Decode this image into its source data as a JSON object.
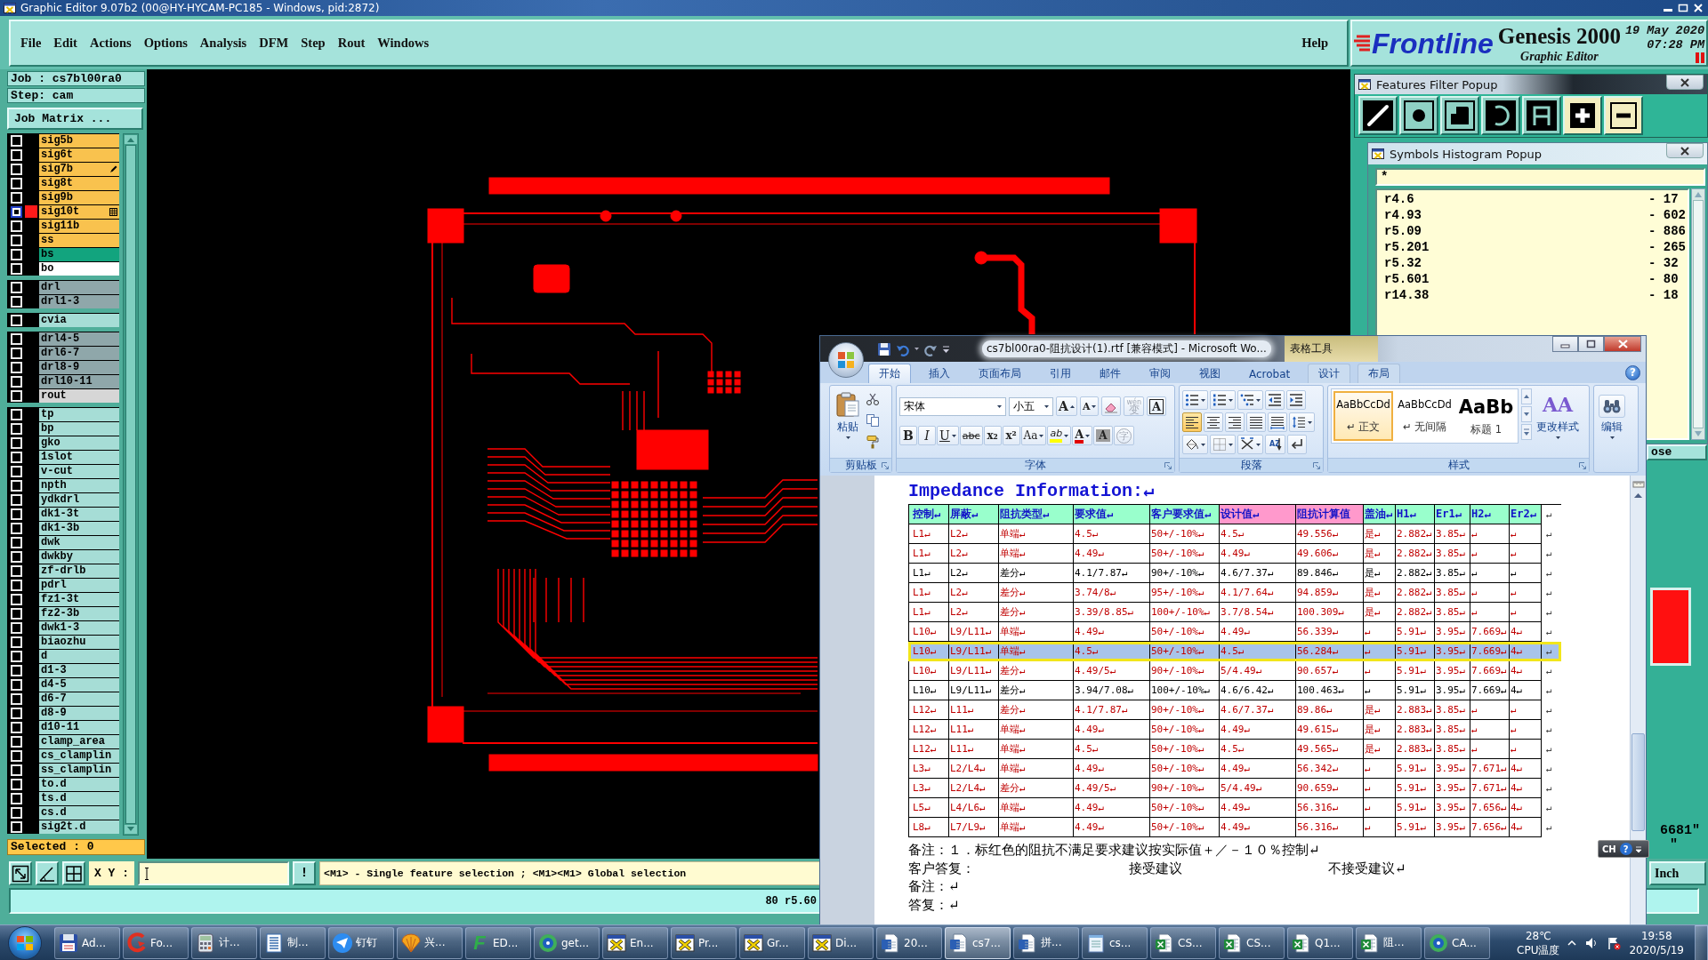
{
  "genesis": {
    "title": "Graphic Editor 9.07b2 (00@HY-HYCAM-PC185 - Windows, pid:2872)",
    "menu": [
      "File",
      "Edit",
      "Actions",
      "Options",
      "Analysis",
      "DFM",
      "Step",
      "Rout",
      "Windows"
    ],
    "help": "Help",
    "brand": {
      "logo": "Frontline",
      "product": "Genesis 2000",
      "subtitle": "Graphic Editor",
      "date": "19 May 2020",
      "time": "07:28 PM"
    },
    "job": "Job : cs7bl00ra0",
    "step": "Step: cam",
    "job_matrix": "Job Matrix ...",
    "layer_groups": [
      [
        {
          "name": "sig5b",
          "kind": "plain",
          "color": "#f9c24e",
          "checked": false,
          "displayed": false
        },
        {
          "name": "sig6t",
          "kind": "plain",
          "color": "#f9c24e",
          "checked": false,
          "displayed": false
        },
        {
          "name": "sig7b",
          "kind": "edited",
          "color": "#f9c24e",
          "checked": false,
          "displayed": false
        },
        {
          "name": "sig8t",
          "kind": "plain",
          "color": "#f9c24e",
          "checked": false,
          "displayed": false
        },
        {
          "name": "sig9b",
          "kind": "plain",
          "color": "#f9c24e",
          "checked": false,
          "displayed": false
        },
        {
          "name": "sig10t",
          "kind": "work",
          "color": "#f9c24e",
          "checked": true,
          "displayed": true
        },
        {
          "name": "sig11b",
          "kind": "plain",
          "color": "#f9c24e",
          "checked": false,
          "displayed": false
        },
        {
          "name": "ss",
          "kind": "plain",
          "color": "#f9c24e",
          "checked": false,
          "displayed": false
        },
        {
          "name": "bs",
          "kind": "plain",
          "color": "#12a47e",
          "checked": false,
          "displayed": false
        },
        {
          "name": "bo",
          "kind": "plain",
          "color": "#ffffff",
          "checked": false,
          "displayed": false
        }
      ],
      [
        {
          "name": "drl",
          "kind": "plain",
          "color": "#8fa7aa",
          "checked": false,
          "displayed": false
        },
        {
          "name": "drl1-3",
          "kind": "plain",
          "color": "#8fa7aa",
          "checked": false,
          "displayed": false
        }
      ],
      [
        {
          "name": "cvia",
          "kind": "plain",
          "color": "#a6ddd6",
          "checked": false,
          "displayed": false
        }
      ],
      [
        {
          "name": "drl4-5",
          "kind": "plain",
          "color": "#8fa7aa",
          "checked": false,
          "displayed": false
        },
        {
          "name": "drl6-7",
          "kind": "plain",
          "color": "#8fa7aa",
          "checked": false,
          "displayed": false
        },
        {
          "name": "drl8-9",
          "kind": "plain",
          "color": "#8fa7aa",
          "checked": false,
          "displayed": false
        },
        {
          "name": "drl10-11",
          "kind": "plain",
          "color": "#8fa7aa",
          "checked": false,
          "displayed": false
        },
        {
          "name": "rout",
          "kind": "plain",
          "color": "#d6d6d6",
          "checked": false,
          "displayed": false
        }
      ],
      [
        {
          "name": "tp",
          "kind": "plain",
          "color": "#a6ddd6",
          "checked": false,
          "displayed": false
        },
        {
          "name": "bp",
          "kind": "plain",
          "color": "#a6ddd6",
          "checked": false,
          "displayed": false
        },
        {
          "name": "gko",
          "kind": "plain",
          "color": "#a6ddd6",
          "checked": false,
          "displayed": false
        },
        {
          "name": "1slot",
          "kind": "plain",
          "color": "#a6ddd6",
          "checked": false,
          "displayed": false
        },
        {
          "name": "v-cut",
          "kind": "plain",
          "color": "#a6ddd6",
          "checked": false,
          "displayed": false
        },
        {
          "name": "npth",
          "kind": "plain",
          "color": "#a6ddd6",
          "checked": false,
          "displayed": false
        },
        {
          "name": "ydkdrl",
          "kind": "plain",
          "color": "#a6ddd6",
          "checked": false,
          "displayed": false
        },
        {
          "name": "dk1-3t",
          "kind": "plain",
          "color": "#a6ddd6",
          "checked": false,
          "displayed": false
        },
        {
          "name": "dk1-3b",
          "kind": "plain",
          "color": "#a6ddd6",
          "checked": false,
          "displayed": false
        },
        {
          "name": "dwk",
          "kind": "plain",
          "color": "#a6ddd6",
          "checked": false,
          "displayed": false
        },
        {
          "name": "dwkby",
          "kind": "plain",
          "color": "#a6ddd6",
          "checked": false,
          "displayed": false
        },
        {
          "name": "zf-drlb",
          "kind": "plain",
          "color": "#a6ddd6",
          "checked": false,
          "displayed": false
        },
        {
          "name": "pdrl",
          "kind": "plain",
          "color": "#a6ddd6",
          "checked": false,
          "displayed": false
        },
        {
          "name": "fz1-3t",
          "kind": "plain",
          "color": "#a6ddd6",
          "checked": false,
          "displayed": false
        },
        {
          "name": "fz2-3b",
          "kind": "plain",
          "color": "#a6ddd6",
          "checked": false,
          "displayed": false
        },
        {
          "name": "dwk1-3",
          "kind": "plain",
          "color": "#a6ddd6",
          "checked": false,
          "displayed": false
        },
        {
          "name": "biaozhu",
          "kind": "plain",
          "color": "#a6ddd6",
          "checked": false,
          "displayed": false
        },
        {
          "name": "d",
          "kind": "plain",
          "color": "#a6ddd6",
          "checked": false,
          "displayed": false
        },
        {
          "name": "d1-3",
          "kind": "plain",
          "color": "#a6ddd6",
          "checked": false,
          "displayed": false
        },
        {
          "name": "d4-5",
          "kind": "plain",
          "color": "#a6ddd6",
          "checked": false,
          "displayed": false
        },
        {
          "name": "d6-7",
          "kind": "plain",
          "color": "#a6ddd6",
          "checked": false,
          "displayed": false
        },
        {
          "name": "d8-9",
          "kind": "plain",
          "color": "#a6ddd6",
          "checked": false,
          "displayed": false
        },
        {
          "name": "d10-11",
          "kind": "plain",
          "color": "#a6ddd6",
          "checked": false,
          "displayed": false
        },
        {
          "name": "clamp_area",
          "kind": "plain",
          "color": "#a6ddd6",
          "checked": false,
          "displayed": false
        },
        {
          "name": "cs_clamplin",
          "kind": "plain",
          "color": "#a6ddd6",
          "checked": false,
          "displayed": false
        },
        {
          "name": "ss_clamplin",
          "kind": "plain",
          "color": "#a6ddd6",
          "checked": false,
          "displayed": false
        },
        {
          "name": "to.d",
          "kind": "plain",
          "color": "#a6ddd6",
          "checked": false,
          "displayed": false
        },
        {
          "name": "ts.d",
          "kind": "plain",
          "color": "#a6ddd6",
          "checked": false,
          "displayed": false
        },
        {
          "name": "cs.d",
          "kind": "plain",
          "color": "#a6ddd6",
          "checked": false,
          "displayed": false
        },
        {
          "name": "sig2t.d",
          "kind": "plain",
          "color": "#a6ddd6",
          "checked": false,
          "displayed": false
        }
      ]
    ],
    "selected": "Selected : 0",
    "coord_label": "X Y :",
    "exec": "!",
    "hint": "<M1> - Single feature selection ; <M1><M1> Global selection",
    "unit": "Inch",
    "status": "80 r5.60",
    "side": {
      "close": "ose",
      "reading": "6681\"",
      "reading_2": "\""
    }
  },
  "features_filter": {
    "title": "Features Filter Popup",
    "tools": [
      {
        "kind": "line"
      },
      {
        "kind": "pad"
      },
      {
        "kind": "surface"
      },
      {
        "kind": "arc"
      },
      {
        "kind": "text"
      },
      {
        "kind": "positive"
      },
      {
        "kind": "negative"
      }
    ]
  },
  "symbols_histogram": {
    "title": "Symbols Histogram Popup",
    "filter": "*",
    "rows": [
      {
        "symbol": "r4.6",
        "count": "- 17"
      },
      {
        "symbol": "r4.93",
        "count": "- 602"
      },
      {
        "symbol": "r5.09",
        "count": "- 886"
      },
      {
        "symbol": "r5.201",
        "count": "- 265"
      },
      {
        "symbol": "r5.32",
        "count": "- 32"
      },
      {
        "symbol": "r5.601",
        "count": "- 80"
      },
      {
        "symbol": "r14.38",
        "count": "- 18"
      }
    ]
  },
  "ime": {
    "lang": "CH",
    "help": "?"
  },
  "word": {
    "title": "cs7bl00ra0-阻抗设计(1).rtf [兼容模式] - Microsoft Wo...",
    "context": "表格工具",
    "help": "?",
    "tabs": [
      {
        "label": "开始",
        "selected": true,
        "contextual": false
      },
      {
        "label": "插入",
        "selected": false,
        "contextual": false
      },
      {
        "label": "页面布局",
        "selected": false,
        "contextual": false
      },
      {
        "label": "引用",
        "selected": false,
        "contextual": false
      },
      {
        "label": "邮件",
        "selected": false,
        "contextual": false
      },
      {
        "label": "审阅",
        "selected": false,
        "contextual": false
      },
      {
        "label": "视图",
        "selected": false,
        "contextual": false
      },
      {
        "label": "Acrobat",
        "selected": false,
        "contextual": false
      },
      {
        "label": "设计",
        "selected": false,
        "contextual": true
      },
      {
        "label": "布局",
        "selected": false,
        "contextual": true
      }
    ],
    "clipboard": {
      "title": "剪贴板",
      "paste": "粘贴"
    },
    "font": {
      "title": "字体",
      "face": "宋体",
      "size": "小五",
      "row1": [
        {
          "kind": "grow",
          "text": "A",
          "disabled": false
        },
        {
          "kind": "shrink",
          "text": "A",
          "disabled": false
        },
        {
          "kind": "clear",
          "disabled": false
        },
        {
          "kind": "phonetic",
          "text": "变",
          "ruby": "wén",
          "disabled": true
        },
        {
          "kind": "border",
          "text": "A",
          "disabled": false
        }
      ],
      "row2": [
        {
          "kind": "bold",
          "text": "B",
          "disabled": false
        },
        {
          "kind": "italic",
          "text": "I",
          "disabled": false
        },
        {
          "kind": "underline",
          "text": "U",
          "disabled": false
        },
        {
          "kind": "strike",
          "text": "abc",
          "disabled": false
        },
        {
          "kind": "subscript",
          "text": "x₂",
          "disabled": false
        },
        {
          "kind": "superscript",
          "text": "x²",
          "disabled": false
        },
        {
          "kind": "case",
          "text": "Aa",
          "disabled": false
        },
        {
          "kind": "highlight",
          "text": "ab",
          "disabled": false
        },
        {
          "kind": "color",
          "text": "A",
          "disabled": false
        },
        {
          "kind": "shading",
          "text": "A",
          "disabled": false
        },
        {
          "kind": "enclose",
          "text": "字",
          "disabled": true
        }
      ]
    },
    "paragraph": {
      "title": "段落",
      "rows": [
        [
          {
            "kind": "bullets",
            "selected": false
          },
          {
            "kind": "numbering",
            "selected": false
          },
          {
            "kind": "multilevel",
            "selected": false
          },
          {
            "kind": "outdent",
            "selected": false
          },
          {
            "kind": "indent",
            "selected": false
          }
        ],
        [
          {
            "kind": "align-left",
            "selected": true
          },
          {
            "kind": "align-center",
            "selected": false
          },
          {
            "kind": "align-right",
            "selected": false
          },
          {
            "kind": "justify",
            "selected": false
          },
          {
            "kind": "distribute",
            "selected": false
          },
          {
            "kind": "line-spacing",
            "selected": false
          }
        ],
        [
          {
            "kind": "fill",
            "selected": false
          },
          {
            "kind": "borders",
            "selected": false
          },
          {
            "kind": "asian",
            "selected": false
          },
          {
            "kind": "sort",
            "text": "AZ",
            "selected": false
          },
          {
            "kind": "marks",
            "selected": false
          }
        ]
      ]
    },
    "styles": {
      "title": "样式",
      "items": [
        {
          "kind": "normal",
          "sample": "AaBbCcDd",
          "name": "↵ 正文",
          "selected": true
        },
        {
          "kind": "normal",
          "sample": "AaBbCcDd",
          "name": "↵ 无间隔",
          "selected": false
        },
        {
          "kind": "heading",
          "sample": "AaBb",
          "name": "标题 1",
          "selected": false
        }
      ],
      "icon": "AA",
      "change": "更改样式"
    },
    "editing": {
      "label": "编辑"
    },
    "document": {
      "heading": "Impedance Information:↵",
      "columns": [
        {
          "label": "控制↵",
          "color": "#99ffcc"
        },
        {
          "label": "屏蔽↵",
          "color": "#99ffcc"
        },
        {
          "label": "阻抗类型↵",
          "color": "#99ffcc"
        },
        {
          "label": "要求值↵",
          "color": "#99ffcc"
        },
        {
          "label": "客户要求值↵",
          "color": "#99ffcc"
        },
        {
          "label": "设计值↵",
          "color": "#ff99cc"
        },
        {
          "label": "阻抗计算值",
          "color": "#ff99cc"
        },
        {
          "label": "盖油↵",
          "color": "#99ffcc"
        },
        {
          "label": "H1↵",
          "color": "#99ffcc"
        },
        {
          "label": "Er1↵",
          "color": "#99ffcc"
        },
        {
          "label": "H2↵",
          "color": "#99ffcc"
        },
        {
          "label": "Er2↵",
          "color": "#99ffcc"
        }
      ],
      "header_end": "↵",
      "rows": [
        {
          "cells": [
            "L1↵",
            "L2↵",
            "单端↵",
            "4.5↵",
            "50+/-10%↵",
            "4.5↵",
            "49.556↵",
            "是↵",
            "2.882↵",
            "3.85↵",
            "↵",
            "↵"
          ],
          "flagged": true,
          "selected": false,
          "end": "↵"
        },
        {
          "cells": [
            "L1↵",
            "L2↵",
            "单端↵",
            "4.49↵",
            "50+/-10%↵",
            "4.49↵",
            "49.606↵",
            "是↵",
            "2.882↵",
            "3.85↵",
            "↵",
            "↵"
          ],
          "flagged": true,
          "selected": false,
          "end": "↵"
        },
        {
          "cells": [
            "L1↵",
            "L2↵",
            "差分↵",
            "4.1/7.87↵",
            "90+/-10%↵",
            "4.6/7.37↵",
            "89.846↵",
            "是↵",
            "2.882↵",
            "3.85↵",
            "↵",
            "↵"
          ],
          "flagged": false,
          "selected": false,
          "end": "↵"
        },
        {
          "cells": [
            "L1↵",
            "L2↵",
            "差分↵",
            "3.74/8↵",
            "95+/-10%↵",
            "4.1/7.64↵",
            "94.859↵",
            "是↵",
            "2.882↵",
            "3.85↵",
            "↵",
            "↵"
          ],
          "flagged": true,
          "selected": false,
          "end": "↵"
        },
        {
          "cells": [
            "L1↵",
            "L2↵",
            "差分↵",
            "3.39/8.85↵",
            "100+/-10%↵",
            "3.7/8.54↵",
            "100.309↵",
            "是↵",
            "2.882↵",
            "3.85↵",
            "↵",
            "↵"
          ],
          "flagged": true,
          "selected": false,
          "end": "↵"
        },
        {
          "cells": [
            "L10↵",
            "L9/L11↵",
            "单端↵",
            "4.49↵",
            "50+/-10%↵",
            "4.49↵",
            "56.339↵",
            "↵",
            "5.91↵",
            "3.95↵",
            "7.669↵",
            "4↵"
          ],
          "flagged": true,
          "selected": false,
          "end": "↵"
        },
        {
          "cells": [
            "L10↵",
            "L9/L11↵",
            "单端↵",
            "4.5↵",
            "50+/-10%↵",
            "4.5↵",
            "56.284↵",
            "↵",
            "5.91↵",
            "3.95↵",
            "7.669↵",
            "4↵"
          ],
          "flagged": true,
          "selected": true,
          "end": "↵"
        },
        {
          "cells": [
            "L10↵",
            "L9/L11↵",
            "差分↵",
            "4.49/5↵",
            "90+/-10%↵",
            "5/4.49↵",
            "90.657↵",
            "↵",
            "5.91↵",
            "3.95↵",
            "7.669↵",
            "4↵"
          ],
          "flagged": true,
          "selected": false,
          "end": "↵"
        },
        {
          "cells": [
            "L10↵",
            "L9/L11↵",
            "差分↵",
            "3.94/7.08↵",
            "100+/-10%↵",
            "4.6/6.42↵",
            "100.463↵",
            "↵",
            "5.91↵",
            "3.95↵",
            "7.669↵",
            "4↵"
          ],
          "flagged": false,
          "selected": false,
          "end": "↵"
        },
        {
          "cells": [
            "L12↵",
            "L11↵",
            "差分↵",
            "4.1/7.87↵",
            "90+/-10%↵",
            "4.6/7.37↵",
            "89.86↵",
            "是↵",
            "2.883↵",
            "3.85↵",
            "↵",
            "↵"
          ],
          "flagged": true,
          "selected": false,
          "end": "↵"
        },
        {
          "cells": [
            "L12↵",
            "L11↵",
            "单端↵",
            "4.49↵",
            "50+/-10%↵",
            "4.49↵",
            "49.615↵",
            "是↵",
            "2.883↵",
            "3.85↵",
            "↵",
            "↵"
          ],
          "flagged": true,
          "selected": false,
          "end": "↵"
        },
        {
          "cells": [
            "L12↵",
            "L11↵",
            "单端↵",
            "4.5↵",
            "50+/-10%↵",
            "4.5↵",
            "49.565↵",
            "是↵",
            "2.883↵",
            "3.85↵",
            "↵",
            "↵"
          ],
          "flagged": true,
          "selected": false,
          "end": "↵"
        },
        {
          "cells": [
            "L3↵",
            "L2/L4↵",
            "单端↵",
            "4.49↵",
            "50+/-10%↵",
            "4.49↵",
            "56.342↵",
            "↵",
            "5.91↵",
            "3.95↵",
            "7.671↵",
            "4↵"
          ],
          "flagged": true,
          "selected": false,
          "end": "↵"
        },
        {
          "cells": [
            "L3↵",
            "L2/L4↵",
            "差分↵",
            "4.49/5↵",
            "90+/-10%↵",
            "5/4.49↵",
            "90.659↵",
            "↵",
            "5.91↵",
            "3.95↵",
            "7.671↵",
            "4↵"
          ],
          "flagged": true,
          "selected": false,
          "end": "↵"
        },
        {
          "cells": [
            "L5↵",
            "L4/L6↵",
            "单端↵",
            "4.49↵",
            "50+/-10%↵",
            "4.49↵",
            "56.316↵",
            "↵",
            "5.91↵",
            "3.95↵",
            "7.656↵",
            "4↵"
          ],
          "flagged": true,
          "selected": false,
          "end": "↵"
        },
        {
          "cells": [
            "L8↵",
            "L7/L9↵",
            "单端↵",
            "4.49↵",
            "50+/-10%↵",
            "4.49↵",
            "56.316↵",
            "↵",
            "5.91↵",
            "3.95↵",
            "7.656↵",
            "4↵"
          ],
          "flagged": true,
          "selected": false,
          "end": "↵"
        }
      ],
      "notes": [
        {
          "kind": "line",
          "text": "备注：１．标红色的阻抗不满足要求建议按实际值＋／－１０％控制↵"
        },
        {
          "kind": "choice",
          "label": "客户答复：",
          "options": [
            "接受建议",
            "不接受建议↵"
          ]
        },
        {
          "kind": "line",
          "text": "备注：↵"
        },
        {
          "kind": "line",
          "text": "答复：↵"
        }
      ]
    }
  },
  "taskbar": {
    "items": [
      {
        "label": "Ad...",
        "kind": "floppy",
        "selected": false
      },
      {
        "label": "Fo...",
        "kind": "swirl",
        "selected": false
      },
      {
        "label": "计...",
        "kind": "calculator",
        "selected": false
      },
      {
        "label": "制...",
        "kind": "lines",
        "selected": false
      },
      {
        "label": "钉钉",
        "kind": "plane",
        "selected": false
      },
      {
        "label": "兴...",
        "kind": "shell",
        "selected": false
      },
      {
        "label": "ED...",
        "kind": "letter",
        "glyph": "F",
        "selected": false
      },
      {
        "label": "get...",
        "kind": "disc",
        "selected": false
      },
      {
        "label": "En...",
        "kind": "window",
        "selected": false
      },
      {
        "label": "Pr...",
        "kind": "window",
        "selected": false
      },
      {
        "label": "Gr...",
        "kind": "window",
        "selected": false
      },
      {
        "label": "Di...",
        "kind": "window",
        "selected": false
      },
      {
        "label": "20...",
        "kind": "document",
        "selected": false
      },
      {
        "label": "cs7...",
        "kind": "document",
        "selected": true
      },
      {
        "label": "拼...",
        "kind": "document",
        "selected": false
      },
      {
        "label": "cs...",
        "kind": "notepad",
        "selected": false
      },
      {
        "label": "CS...",
        "kind": "sheet",
        "selected": false
      },
      {
        "label": "CS...",
        "kind": "sheet",
        "selected": false
      },
      {
        "label": "Q1...",
        "kind": "sheet",
        "selected": false
      },
      {
        "label": "阻...",
        "kind": "sheet",
        "selected": false
      },
      {
        "label": "CA...",
        "kind": "disc",
        "selected": false
      }
    ],
    "temp": "28℃",
    "temp_label": "CPU温度",
    "time": "19:58",
    "date": "2020/5/19"
  }
}
